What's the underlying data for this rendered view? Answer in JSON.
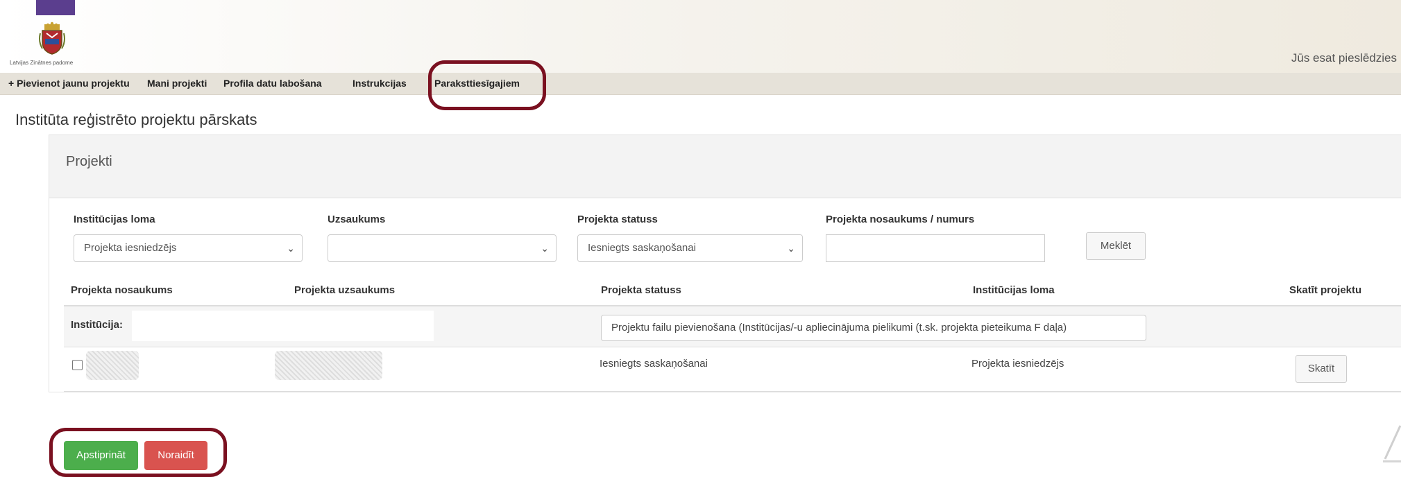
{
  "header": {
    "org_name": "Latvijas Zinātnes padome",
    "login_text": "Jūs esat pieslēdzies"
  },
  "nav": {
    "items": [
      {
        "label": "+ Pievienot jaunu projektu"
      },
      {
        "label": "Mani projekti"
      },
      {
        "label": "Profila datu labošana"
      },
      {
        "label": "Instrukcijas"
      },
      {
        "label": "Paraksttiesīgajiem"
      }
    ]
  },
  "page": {
    "title": "Institūta reģistrēto projektu pārskats"
  },
  "panel": {
    "title": "Projekti"
  },
  "filters": {
    "role": {
      "label": "Institūcijas loma",
      "value": "Projekta iesniedzējs"
    },
    "call": {
      "label": "Uzsaukums",
      "value": ""
    },
    "status": {
      "label": "Projekta statuss",
      "value": "Iesniegts saskaņošanai"
    },
    "name": {
      "label": "Projekta nosaukums / numurs",
      "value": ""
    },
    "search_button": "Meklēt"
  },
  "table": {
    "columns": [
      "Projekta nosaukums",
      "Projekta uzsaukums",
      "Projekta statuss",
      "Institūcijas loma",
      "Skatīt projektu"
    ],
    "institution_label": "Institūcija:",
    "status_filter_value": "Projektu failu pievienošana (Institūcijas/-u apliecinājuma pielikumi (t.sk. projekta pieteikuma F daļa)",
    "rows": [
      {
        "status": "Iesniegts saskaņošanai",
        "role": "Projekta iesniedzējs",
        "view_button": "Skatīt"
      }
    ]
  },
  "actions": {
    "approve": "Apstiprināt",
    "reject": "Noraidīt"
  },
  "colors": {
    "highlight": "#7a1020",
    "success": "#4cae4c",
    "danger": "#d9534f",
    "nav_bg": "#e6e2d9",
    "brand_purple": "#5b3e8e"
  }
}
